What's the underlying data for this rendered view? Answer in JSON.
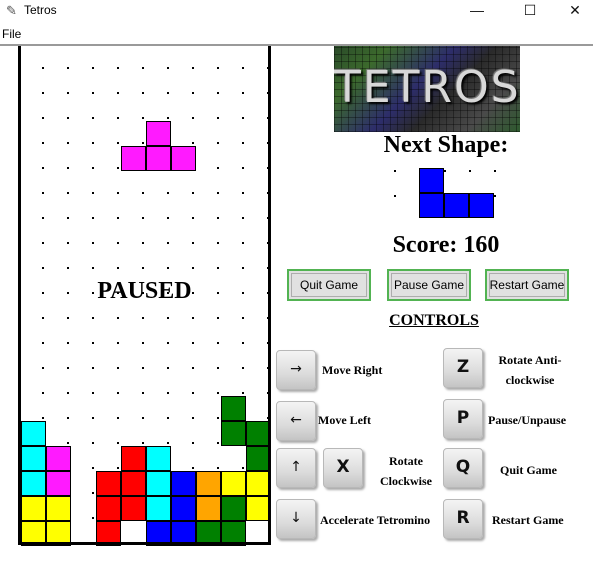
{
  "window": {
    "title": "Tetros",
    "minimize": "—",
    "maximize": "☐",
    "close": "✕"
  },
  "menu": {
    "file": "File"
  },
  "board": {
    "status": "PAUSED",
    "cols": 10,
    "rows": 20,
    "falling": [
      {
        "row": 3,
        "col": 5,
        "color": "#ff1aff"
      },
      {
        "row": 4,
        "col": 4,
        "color": "#ff1aff"
      },
      {
        "row": 4,
        "col": 5,
        "color": "#ff1aff"
      },
      {
        "row": 4,
        "col": 6,
        "color": "#ff1aff"
      }
    ],
    "stack": [
      {
        "row": 14,
        "col": 8,
        "color": "#008000"
      },
      {
        "row": 15,
        "col": 0,
        "color": "#00ffff"
      },
      {
        "row": 15,
        "col": 8,
        "color": "#008000"
      },
      {
        "row": 15,
        "col": 9,
        "color": "#008000"
      },
      {
        "row": 16,
        "col": 0,
        "color": "#00ffff"
      },
      {
        "row": 16,
        "col": 1,
        "color": "#ff1aff"
      },
      {
        "row": 16,
        "col": 4,
        "color": "#ff0000"
      },
      {
        "row": 16,
        "col": 5,
        "color": "#00ffff"
      },
      {
        "row": 16,
        "col": 9,
        "color": "#008000"
      },
      {
        "row": 17,
        "col": 0,
        "color": "#00ffff"
      },
      {
        "row": 17,
        "col": 1,
        "color": "#ff1aff"
      },
      {
        "row": 17,
        "col": 3,
        "color": "#ff0000"
      },
      {
        "row": 17,
        "col": 4,
        "color": "#ff0000"
      },
      {
        "row": 17,
        "col": 5,
        "color": "#00ffff"
      },
      {
        "row": 17,
        "col": 6,
        "color": "#0000ff"
      },
      {
        "row": 17,
        "col": 7,
        "color": "#ffa500"
      },
      {
        "row": 17,
        "col": 8,
        "color": "#ffff00"
      },
      {
        "row": 17,
        "col": 9,
        "color": "#ffff00"
      },
      {
        "row": 18,
        "col": 0,
        "color": "#ffff00"
      },
      {
        "row": 18,
        "col": 1,
        "color": "#ffff00"
      },
      {
        "row": 18,
        "col": 3,
        "color": "#ff0000"
      },
      {
        "row": 18,
        "col": 4,
        "color": "#ff0000"
      },
      {
        "row": 18,
        "col": 5,
        "color": "#00ffff"
      },
      {
        "row": 18,
        "col": 6,
        "color": "#0000ff"
      },
      {
        "row": 18,
        "col": 7,
        "color": "#ffa500"
      },
      {
        "row": 18,
        "col": 8,
        "color": "#008000"
      },
      {
        "row": 18,
        "col": 9,
        "color": "#ffff00"
      },
      {
        "row": 19,
        "col": 0,
        "color": "#ffff00"
      },
      {
        "row": 19,
        "col": 1,
        "color": "#ffff00"
      },
      {
        "row": 19,
        "col": 3,
        "color": "#ff0000"
      },
      {
        "row": 19,
        "col": 5,
        "color": "#0000ff"
      },
      {
        "row": 19,
        "col": 6,
        "color": "#0000ff"
      },
      {
        "row": 19,
        "col": 7,
        "color": "#008000"
      },
      {
        "row": 19,
        "col": 8,
        "color": "#008000"
      }
    ]
  },
  "logo": {
    "text": "TETROS"
  },
  "next": {
    "label": "Next Shape:",
    "cells": [
      {
        "row": 0,
        "col": 1,
        "color": "#0000ff"
      },
      {
        "row": 1,
        "col": 1,
        "color": "#0000ff"
      },
      {
        "row": 1,
        "col": 2,
        "color": "#0000ff"
      },
      {
        "row": 1,
        "col": 3,
        "color": "#0000ff"
      }
    ]
  },
  "score": {
    "text": "Score: 160"
  },
  "buttons": {
    "quit": "Quit Game",
    "pause": "Pause Game",
    "restart": "Restart Game"
  },
  "controls": {
    "heading": "CONTROLS",
    "move_right": {
      "key": "→",
      "label": "Move Right"
    },
    "move_left": {
      "key": "←",
      "label": "Move Left"
    },
    "rotate_cw": {
      "key1": "↑",
      "key2": "X",
      "label": "Rotate Clockwise"
    },
    "accelerate": {
      "key": "↓",
      "label": "Accelerate Tetromino"
    },
    "rotate_acw": {
      "key": "Z",
      "label": "Rotate Anti-clockwise"
    },
    "pause": {
      "key": "P",
      "label": "Pause/Unpause"
    },
    "quit": {
      "key": "Q",
      "label": "Quit Game"
    },
    "restart": {
      "key": "R",
      "label": "Restart Game"
    }
  }
}
